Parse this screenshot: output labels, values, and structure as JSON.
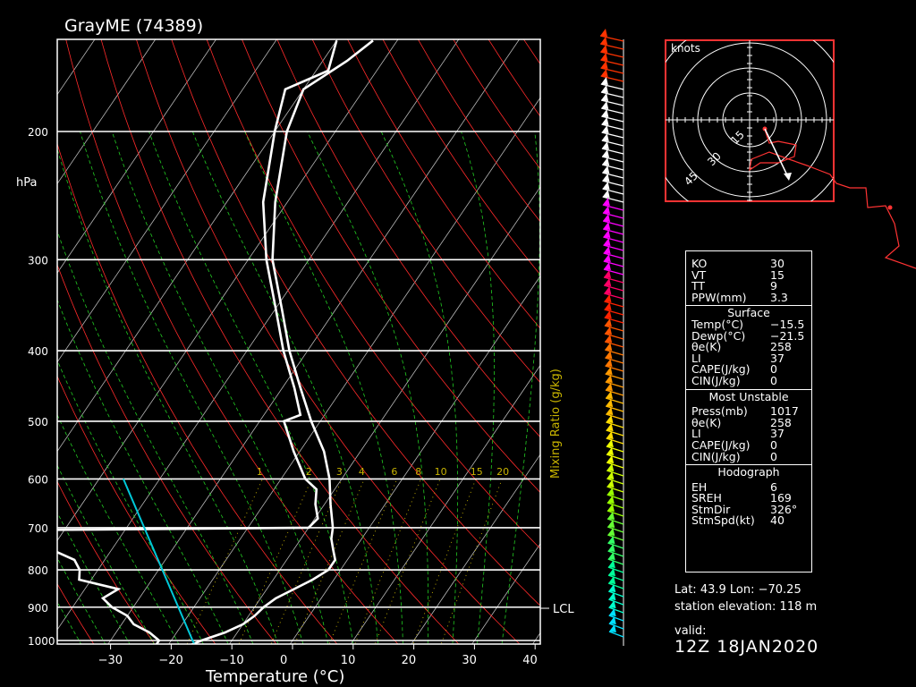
{
  "title": "GrayME (74389)",
  "pressure_unit_label": "hPa",
  "xlabel": "Temperature (°C)",
  "mixing_ratio_label": "Mixing Ratio (g/kg)",
  "lcl_label": "LCL",
  "hodograph_unit": "knots",
  "hodograph_ring_labels": [
    "15",
    "30",
    "45"
  ],
  "colors": {
    "isobar": "#ffffff",
    "isotherm": "#b8b8b8",
    "dry_adiabat": "#ff2a2a",
    "moist_adiabat": "#22cc22",
    "mixing_ratio": "#c8b400",
    "parcel": "#00c8d8",
    "profile": "#ffffff",
    "hodograph_box": "#ff3333"
  },
  "chart_data": {
    "type": "line",
    "title": "GrayME (74389)",
    "xlabel": "Temperature (°C)",
    "ylabel": "hPa",
    "x_ticks": [
      -30,
      -20,
      -10,
      0,
      10,
      20,
      30,
      40
    ],
    "y_ticks": [
      200,
      300,
      400,
      500,
      600,
      700,
      800,
      900,
      1000
    ],
    "mixing_ratio_ticks": [
      "1",
      "2",
      "3",
      "4",
      "6",
      "8",
      "10",
      "15",
      "20"
    ],
    "ylim": [
      150,
      1017
    ],
    "xlim": [
      -40,
      40
    ],
    "skew": "skew-T log-p",
    "series": [
      {
        "kind": "temperature",
        "points": [
          [
            1017,
            -16.5
          ],
          [
            1000,
            -15.0
          ],
          [
            975,
            -12.0
          ],
          [
            950,
            -10.0
          ],
          [
            925,
            -9.0
          ],
          [
            900,
            -8.5
          ],
          [
            875,
            -7.5
          ],
          [
            850,
            -5.5
          ],
          [
            825,
            -3.5
          ],
          [
            800,
            -2.0
          ],
          [
            775,
            -2.0
          ],
          [
            750,
            -3.5
          ],
          [
            725,
            -5.0
          ],
          [
            700,
            -6.0
          ],
          [
            650,
            -9.0
          ],
          [
            600,
            -12.0
          ],
          [
            550,
            -16.0
          ],
          [
            500,
            -21.5
          ],
          [
            450,
            -27.0
          ],
          [
            400,
            -33.0
          ],
          [
            350,
            -39.0
          ],
          [
            300,
            -46.0
          ],
          [
            250,
            -52.0
          ],
          [
            200,
            -58.0
          ],
          [
            175,
            -60.0
          ],
          [
            160,
            -56.0
          ],
          [
            150,
            -54.0
          ]
        ]
      },
      {
        "kind": "dewpoint",
        "points": [
          [
            1017,
            -22.0
          ],
          [
            1000,
            -22.0
          ],
          [
            975,
            -24.5
          ],
          [
            950,
            -28.0
          ],
          [
            925,
            -30.0
          ],
          [
            900,
            -33.5
          ],
          [
            875,
            -36.0
          ],
          [
            850,
            -34.5
          ],
          [
            825,
            -42.0
          ],
          [
            800,
            -43.0
          ],
          [
            775,
            -45.0
          ],
          [
            750,
            -50.0
          ],
          [
            725,
            -55.0
          ],
          [
            705,
            -52.0
          ],
          [
            700,
            -10.0
          ],
          [
            680,
            -9.5
          ],
          [
            650,
            -11.5
          ],
          [
            620,
            -13.0
          ],
          [
            600,
            -16.0
          ],
          [
            550,
            -21.0
          ],
          [
            500,
            -26.0
          ],
          [
            490,
            -24.0
          ],
          [
            450,
            -28.0
          ],
          [
            400,
            -34.0
          ],
          [
            350,
            -40.0
          ],
          [
            300,
            -47.0
          ],
          [
            250,
            -54.0
          ],
          [
            200,
            -60.0
          ],
          [
            175,
            -63.0
          ],
          [
            165,
            -58.0
          ],
          [
            150,
            -60.0
          ]
        ]
      },
      {
        "kind": "parcel",
        "points": [
          [
            1017,
            -15.5
          ],
          [
            600,
            -46.0
          ]
        ]
      }
    ]
  },
  "wind_barbs_label": "wind profile",
  "indices": {
    "rows1": [
      {
        "k": "KO",
        "v": "30"
      },
      {
        "k": "VT",
        "v": "15"
      },
      {
        "k": "TT",
        "v": "9"
      },
      {
        "k": "PPW(mm)",
        "v": "3.3"
      }
    ],
    "surface_header": "Surface",
    "surface": [
      {
        "k": "Temp(°C)",
        "v": "−15.5"
      },
      {
        "k": "Dewp(°C)",
        "v": "−21.5"
      },
      {
        "k": "θe(K)",
        "v": "258"
      },
      {
        "k": "LI",
        "v": "37"
      },
      {
        "k": "CAPE(J/kg)",
        "v": "0"
      },
      {
        "k": "CIN(J/kg)",
        "v": "0"
      }
    ],
    "mu_header": "Most Unstable",
    "mu": [
      {
        "k": "Press(mb)",
        "v": "1017"
      },
      {
        "k": "θe(K)",
        "v": "258"
      },
      {
        "k": "LI",
        "v": "37"
      },
      {
        "k": "CAPE(J/kg)",
        "v": "0"
      },
      {
        "k": "CIN(J/kg)",
        "v": "0"
      }
    ],
    "hodo_header": "Hodograph",
    "hodo": [
      {
        "k": "EH",
        "v": "6"
      },
      {
        "k": "SREH",
        "v": "169"
      },
      {
        "k": "StmDir",
        "v": "326°"
      },
      {
        "k": "StmSpd(kt)",
        "v": "40"
      }
    ]
  },
  "station": {
    "latlon": "Lat: 43.9 Lon: −70.25",
    "elevation": "station elevation: 118 m",
    "valid_label": "valid:",
    "valid_time": "12Z  18JAN2020"
  }
}
